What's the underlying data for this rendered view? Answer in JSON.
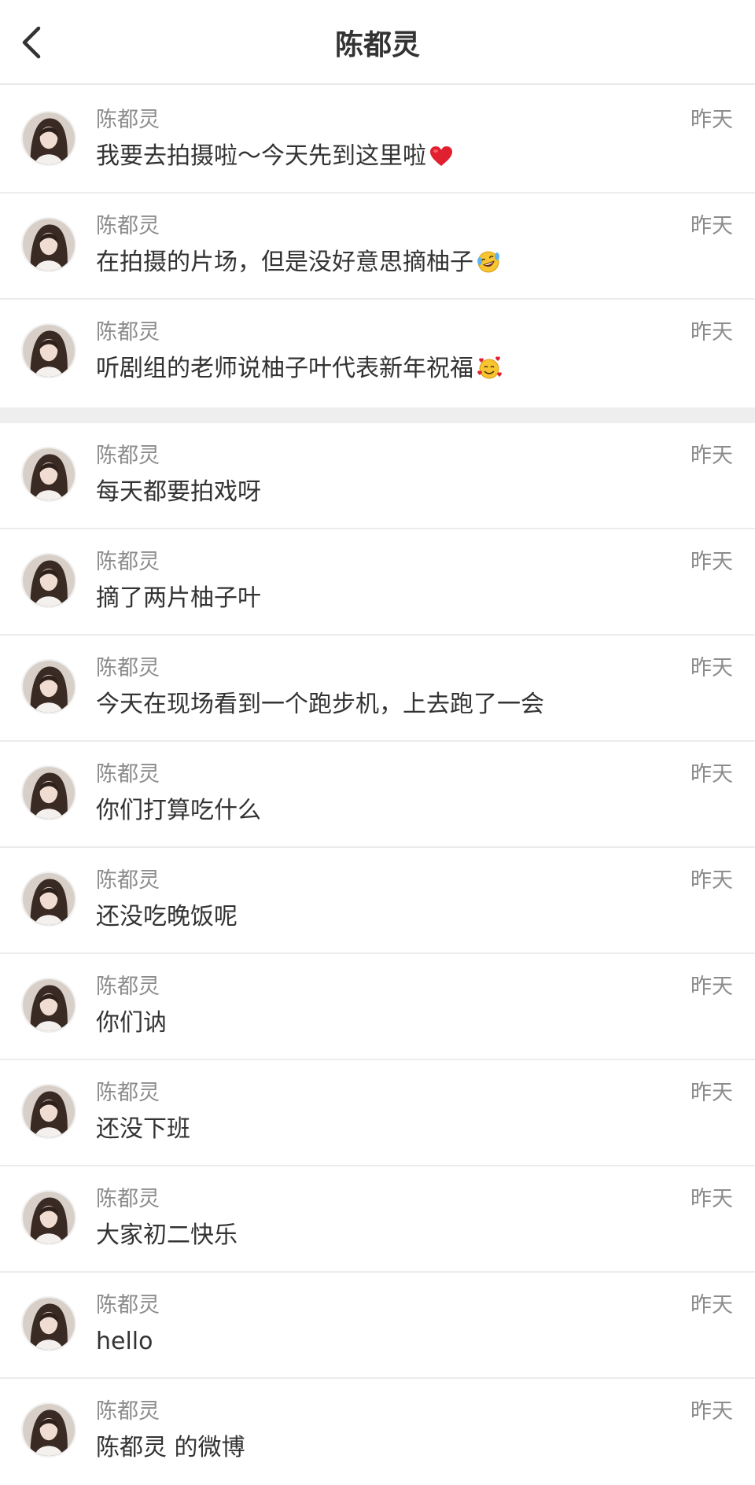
{
  "header": {
    "title": "陈都灵"
  },
  "messages_group_1": [
    {
      "name": "陈都灵",
      "time": "昨天",
      "text": "我要去拍摄啦～今天先到这里啦",
      "emoji": "red-heart"
    },
    {
      "name": "陈都灵",
      "time": "昨天",
      "text": "在拍摄的片场，但是没好意思摘柚子",
      "emoji": "laughing-crying-face"
    },
    {
      "name": "陈都灵",
      "time": "昨天",
      "text": "听剧组的老师说柚子叶代表新年祝福",
      "emoji": "smiling-face-with-hearts"
    }
  ],
  "messages_group_2": [
    {
      "name": "陈都灵",
      "time": "昨天",
      "text": "每天都要拍戏呀"
    },
    {
      "name": "陈都灵",
      "time": "昨天",
      "text": "摘了两片柚子叶"
    },
    {
      "name": "陈都灵",
      "time": "昨天",
      "text": "今天在现场看到一个跑步机，上去跑了一会"
    },
    {
      "name": "陈都灵",
      "time": "昨天",
      "text": "你们打算吃什么"
    },
    {
      "name": "陈都灵",
      "time": "昨天",
      "text": "还没吃晚饭呢"
    },
    {
      "name": "陈都灵",
      "time": "昨天",
      "text": "你们讷"
    },
    {
      "name": "陈都灵",
      "time": "昨天",
      "text": "还没下班"
    },
    {
      "name": "陈都灵",
      "time": "昨天",
      "text": "大家初二快乐"
    },
    {
      "name": "陈都灵",
      "time": "昨天",
      "text": "hello"
    },
    {
      "name": "陈都灵",
      "time": "昨天",
      "text": "陈都灵 的微博"
    }
  ],
  "icons": {
    "back": "chevron-left-icon",
    "avatar": "user-avatar-photo"
  },
  "colors": {
    "background": "#ffffff",
    "separator_band": "#eeeeee",
    "name_text": "#8c8c8c",
    "message_text": "#333333",
    "heart": "#e0202e"
  }
}
